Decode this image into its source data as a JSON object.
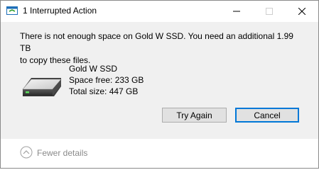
{
  "window": {
    "title": "1 Interrupted Action",
    "minimize_icon": "minimize-icon",
    "maximize_icon": "maximize-icon",
    "close_icon": "close-icon"
  },
  "message": {
    "line1": "There is not enough space on Gold W SSD. You need an additional 1.99 TB",
    "line2": "to copy these files."
  },
  "drive": {
    "icon": "hard-drive-icon",
    "name": "Gold W SSD",
    "space_free": "Space free: 233 GB",
    "total_size": "Total size: 447 GB"
  },
  "buttons": {
    "try_again": "Try Again",
    "cancel": "Cancel"
  },
  "footer": {
    "details_label": "Fewer details",
    "details_icon": "chevron-up-circle-icon"
  }
}
